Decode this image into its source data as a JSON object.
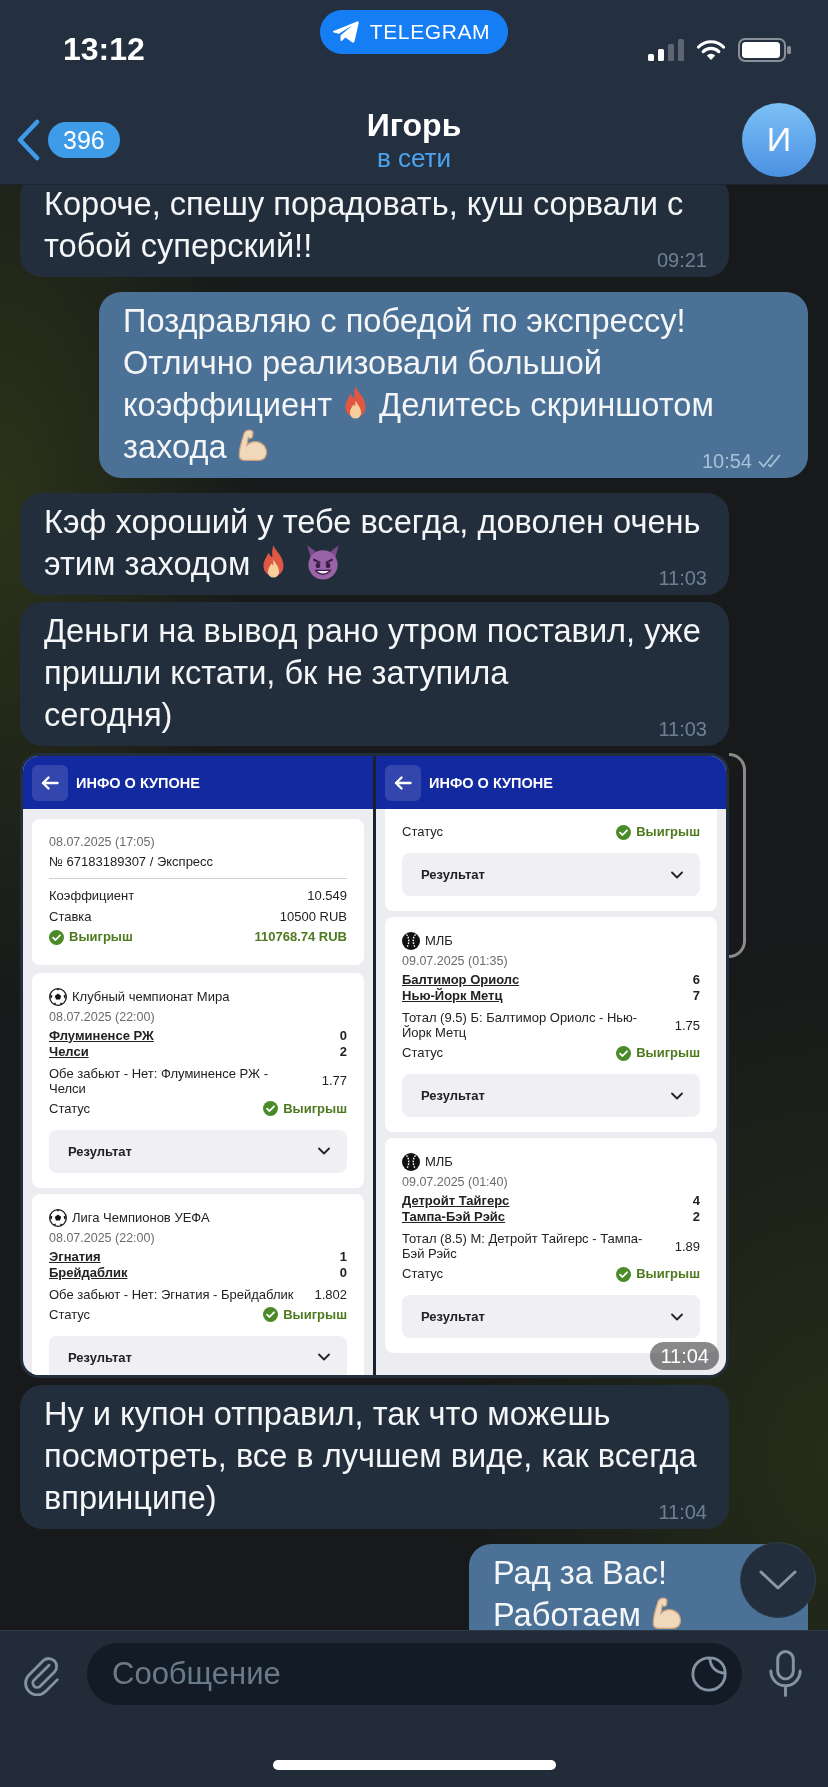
{
  "status_bar": {
    "time": "13:12",
    "return_pill": "TELEGRAM"
  },
  "header": {
    "unread_count": "396",
    "title": "Игорь",
    "subtitle": "в сети",
    "avatar_letter": "И"
  },
  "messages": [
    {
      "kind": "text",
      "outgoing": false,
      "paragraphs": [
        {
          "lines": [
            [
              {
                "kind": "text",
                "text": "Короче, спешу порадовать, куш сорвали с"
              }
            ],
            [
              {
                "kind": "text",
                "text": "тобой суперский!!"
              }
            ]
          ]
        }
      ],
      "time": "09:21"
    },
    {
      "kind": "text",
      "outgoing": true,
      "paragraphs": [
        {
          "lines": [
            [
              {
                "kind": "text",
                "text": "Поздравляю с победой по экспрессу!"
              }
            ],
            [
              {
                "kind": "text",
                "text": "Отлично реализовали большой"
              }
            ],
            [
              {
                "kind": "text",
                "text": "коэффициент"
              },
              {
                "kind": "fire"
              },
              {
                "kind": "text",
                "text": "Делитесь скриншотом"
              }
            ],
            [
              {
                "kind": "text",
                "text": "захода"
              },
              {
                "kind": "flexed_biceps"
              }
            ]
          ]
        }
      ],
      "time": "10:54",
      "read": true
    },
    {
      "kind": "text",
      "outgoing": false,
      "paragraphs": [
        {
          "lines": [
            [
              {
                "kind": "text",
                "text": "Кэф хороший у тебе всегда, доволен очень"
              }
            ],
            [
              {
                "kind": "text",
                "text": "этим заходом"
              },
              {
                "kind": "fire"
              },
              {
                "kind": "devil"
              }
            ]
          ]
        }
      ],
      "time": "11:03"
    },
    {
      "kind": "text",
      "outgoing": false,
      "paragraphs": [
        {
          "lines": [
            [
              {
                "kind": "text",
                "text": "Деньги на вывод рано утром поставил, уже"
              }
            ],
            [
              {
                "kind": "text",
                "text": "пришли кстати, бк не затупила"
              }
            ]
          ]
        },
        {
          "lines": [
            [
              {
                "kind": "text",
                "text": "сегодня)"
              }
            ]
          ]
        }
      ],
      "time": "11:03"
    },
    {
      "kind": "image",
      "outgoing": false,
      "time": "11:04",
      "screens": [
        {
          "title": "ИНФО О КУПОНЕ",
          "summary": {
            "date": "08.07.2025 (17:05)",
            "number": "№ 67183189307 / Экспресс",
            "rows": [
              {
                "label": "Коэффициент",
                "value": "10.549"
              },
              {
                "label": "Ставка",
                "value": "10500 RUB"
              }
            ],
            "result": {
              "label": "Выигрыш",
              "value": "110768.74 RUB",
              "won": true
            }
          },
          "events": [
            {
              "kind": "football",
              "league": "Клубный чемпионат Мира",
              "date": "08.07.2025 (22:00)",
              "teams": [
                {
                  "name": "Флуминенсе РЖ",
                  "score": "0"
                },
                {
                  "name": "Челси",
                  "score": "2"
                }
              ],
              "bet": "Обе забьют - Нет: Флуминенсе РЖ - Челси",
              "odds": "1.77",
              "status_label": "Статус",
              "status": "Выигрыш",
              "won": true,
              "result_button": "Результат"
            },
            {
              "kind": "football",
              "league": "Лига Чемпионов УЕФА",
              "date": "08.07.2025 (22:00)",
              "teams": [
                {
                  "name": "Эгнатия",
                  "score": "1"
                },
                {
                  "name": "Брейдаблик",
                  "score": "0"
                }
              ],
              "bet": "Обе забьют - Нет: Эгнатия - Брейдаблик",
              "odds": "1.802",
              "status_label": "Статус",
              "status": "Выигрыш",
              "won": true,
              "result_button": "Результат"
            }
          ]
        },
        {
          "title": "ИНФО О КУПОНЕ",
          "events": [
            {
              "status_label": "Статус",
              "status": "Выигрыш",
              "won": true,
              "result_button": "Результат"
            },
            {
              "kind": "baseball",
              "league": "МЛБ",
              "date": "09.07.2025 (01:35)",
              "teams": [
                {
                  "name": "Балтимор Ориолс",
                  "score": "6"
                },
                {
                  "name": "Нью-Йорк Метц",
                  "score": "7"
                }
              ],
              "bet": "Тотал (9.5) Б: Балтимор Ориолс - Нью-Йорк Метц",
              "odds": "1.75",
              "status_label": "Статус",
              "status": "Выигрыш",
              "won": true,
              "result_button": "Результат"
            },
            {
              "kind": "baseball",
              "league": "МЛБ",
              "date": "09.07.2025 (01:40)",
              "teams": [
                {
                  "name": "Детройт Тайгерс",
                  "score": "4"
                },
                {
                  "name": "Тампа-Бэй Рэйс",
                  "score": "2"
                }
              ],
              "bet": "Тотал (8.5) М: Детройт Тайгерс - Тампа-Бэй Рэйс",
              "odds": "1.89",
              "status_label": "Статус",
              "status": "Выигрыш",
              "won": true,
              "result_button": "Результат"
            }
          ]
        }
      ]
    },
    {
      "kind": "text",
      "outgoing": false,
      "paragraphs": [
        {
          "lines": [
            [
              {
                "kind": "text",
                "text": "Ну и купон отправил, так что можешь"
              }
            ],
            [
              {
                "kind": "text",
                "text": "посмотреть, все в лучшем виде, как всегда"
              }
            ],
            [
              {
                "kind": "text",
                "text": "впринципе)"
              }
            ]
          ]
        }
      ],
      "time": "11:04"
    },
    {
      "kind": "text",
      "outgoing": true,
      "paragraphs": [
        {
          "lines": [
            [
              {
                "kind": "text",
                "text": "Рад за Вас!"
              }
            ]
          ]
        },
        {
          "lines": [
            [
              {
                "kind": "text",
                "text": "Работаем"
              },
              {
                "kind": "flexed_biceps"
              }
            ]
          ]
        }
      ]
    }
  ],
  "composer": {
    "placeholder": "Сообщение"
  }
}
